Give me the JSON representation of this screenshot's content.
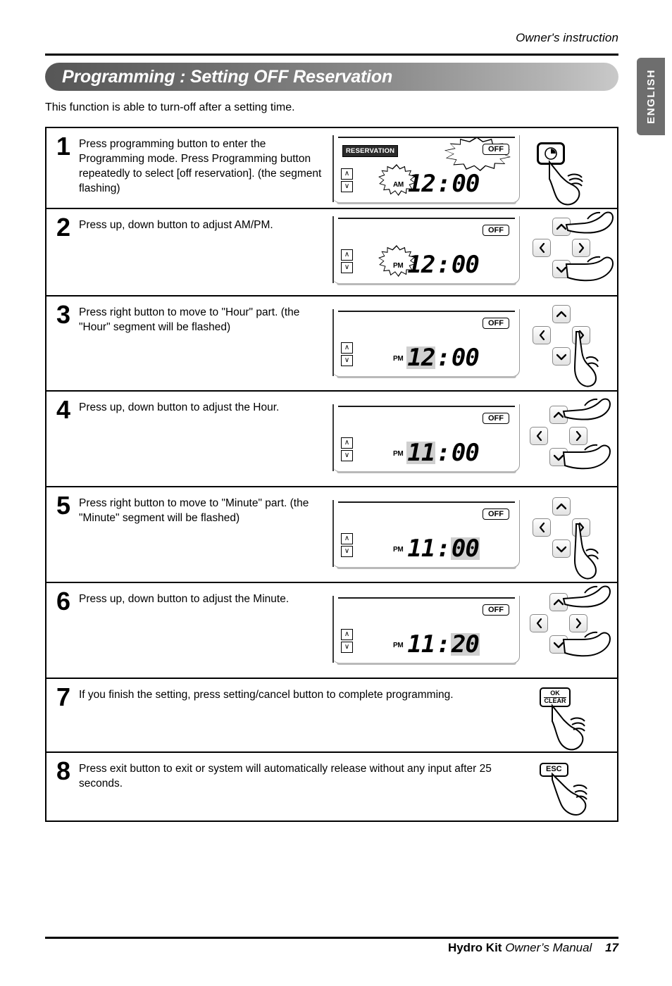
{
  "header": {
    "instruction": "Owner's instruction",
    "language_tab": "ENGLISH"
  },
  "title": "Programming : Setting OFF Reservation",
  "intro": "This function is able to turn-off after a setting time.",
  "steps": [
    {
      "number": "1",
      "text": "Press programming button to enter the Programming mode. Press Programming button repeatedly to select [off reservation]. (the segment flashing)",
      "display": {
        "reservation_badge": "RESERVATION",
        "off_badge": "OFF",
        "off_flashing": true,
        "ampm": "AM",
        "ampm_flashing": true,
        "hour": "12",
        "separator": ":",
        "minute": "00",
        "hour_highlight": false,
        "minute_highlight": false,
        "up_arrow": "∧",
        "down_arrow": "∨"
      },
      "control": {
        "type": "clock-button",
        "icon": "clock-icon",
        "hand": true
      }
    },
    {
      "number": "2",
      "text": "Press up, down button to adjust AM/PM.",
      "display": {
        "reservation_badge": "",
        "off_badge": "OFF",
        "off_flashing": false,
        "ampm": "PM",
        "ampm_flashing": true,
        "hour": "12",
        "separator": ":",
        "minute": "00",
        "hour_highlight": false,
        "minute_highlight": false,
        "up_arrow": "∧",
        "down_arrow": "∨"
      },
      "control": {
        "type": "dpad",
        "pressed": "up-and-down",
        "hand": true
      }
    },
    {
      "number": "3",
      "text": "Press right button to move to \"Hour\" part. (the \"Hour\" segment will be flashed)",
      "display": {
        "reservation_badge": "",
        "off_badge": "OFF",
        "off_flashing": false,
        "ampm": "PM",
        "ampm_flashing": false,
        "hour": "12",
        "separator": ":",
        "minute": "00",
        "hour_highlight": true,
        "minute_highlight": false,
        "up_arrow": "∧",
        "down_arrow": "∨"
      },
      "control": {
        "type": "dpad",
        "pressed": "right",
        "hand": true
      }
    },
    {
      "number": "4",
      "text": "Press up, down button to adjust the Hour.",
      "display": {
        "reservation_badge": "",
        "off_badge": "OFF",
        "off_flashing": false,
        "ampm": "PM",
        "ampm_flashing": false,
        "hour": "11",
        "separator": ":",
        "minute": "00",
        "hour_highlight": true,
        "minute_highlight": false,
        "up_arrow": "∧",
        "down_arrow": "∨"
      },
      "control": {
        "type": "dpad",
        "pressed": "up-and-down",
        "hand": true
      }
    },
    {
      "number": "5",
      "text": "Press right button to move to \"Minute\" part. (the \"Minute\" segment will be flashed)",
      "display": {
        "reservation_badge": "",
        "off_badge": "OFF",
        "off_flashing": false,
        "ampm": "PM",
        "ampm_flashing": false,
        "hour": "11",
        "separator": ":",
        "minute": "00",
        "hour_highlight": false,
        "minute_highlight": true,
        "up_arrow": "∧",
        "down_arrow": "∨"
      },
      "control": {
        "type": "dpad",
        "pressed": "right",
        "hand": true
      }
    },
    {
      "number": "6",
      "text": "Press up, down button to adjust the Minute.",
      "display": {
        "reservation_badge": "",
        "off_badge": "OFF",
        "off_flashing": false,
        "ampm": "PM",
        "ampm_flashing": false,
        "hour": "11",
        "separator": ":",
        "minute": "20",
        "hour_highlight": false,
        "minute_highlight": true,
        "up_arrow": "∧",
        "down_arrow": "∨"
      },
      "control": {
        "type": "dpad",
        "pressed": "up-and-down",
        "hand": true
      }
    },
    {
      "number": "7",
      "text": "If you finish the setting, press setting/cancel button to complete programming.",
      "control": {
        "type": "ok-clear-button",
        "label_top": "OK",
        "label_bottom": "CLEAR",
        "hand": true
      }
    },
    {
      "number": "8",
      "text": "Press exit button to exit or system will automatically release without any input after 25 seconds.",
      "control": {
        "type": "esc-button",
        "label": "ESC",
        "hand": true
      }
    }
  ],
  "footer": {
    "product": "Hydro Kit",
    "manual": "Owner’s Manual",
    "page": "17"
  },
  "colors": {
    "title_bar_dark": "#565656",
    "title_bar_light": "#c9c9c9",
    "lang_tab": "#6e6e6e",
    "segment_highlight": "#cfcfcf",
    "badge_bg": "#2b2b2b"
  }
}
